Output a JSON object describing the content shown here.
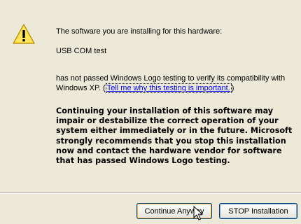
{
  "dialog": {
    "intro": "The software you are installing for this hardware:",
    "device_name": "USB COM test",
    "not_passed_prefix": "has not passed Windows Logo testing to verify its compatibility with Windows XP. (",
    "link_text": "Tell me why this testing is important.",
    "not_passed_suffix": ")",
    "warning_text": "Continuing your installation of this software may impair or destabilize the correct operation of your system either immediately or in the future. Microsoft strongly recommends that you stop this installation now and contact the hardware vendor for software that has passed Windows Logo testing.",
    "icon": "warning-icon"
  },
  "buttons": {
    "continue_label": "Continue Anyway",
    "stop_label": "STOP Installation"
  },
  "colors": {
    "background": "#ece9d8",
    "link": "#0000ff",
    "warning_icon_fill": "#ffcc00"
  }
}
